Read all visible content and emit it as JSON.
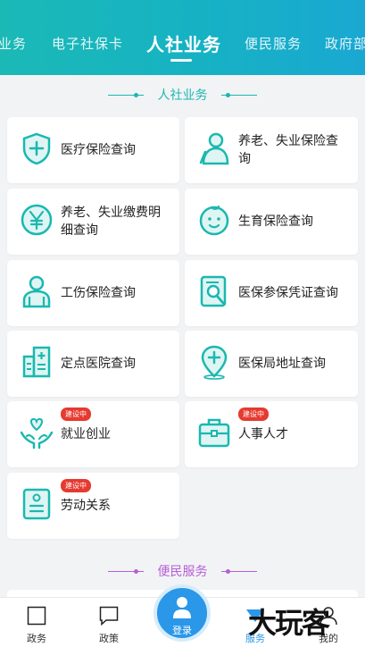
{
  "top_tabs": [
    {
      "label": "业务"
    },
    {
      "label": "电子社保卡"
    },
    {
      "label": "人社业务"
    },
    {
      "label": "便民服务"
    },
    {
      "label": "政府部"
    }
  ],
  "section1": {
    "title": "人社业务",
    "color": "#1ab8b0"
  },
  "cards": [
    {
      "label_line1": "医疗保险查询",
      "label_line2": "",
      "icon": "shield-plus-icon"
    },
    {
      "label_line1": "养老、失业保险查",
      "label_line2": "询",
      "icon": "elderly-person-icon"
    },
    {
      "label_line1": "养老、失业缴费明",
      "label_line2": "细查询",
      "icon": "yuan-coin-icon"
    },
    {
      "label_line1": "生育保险查询",
      "label_line2": "",
      "icon": "baby-face-icon"
    },
    {
      "label_line1": "工伤保险查询",
      "label_line2": "",
      "icon": "injured-person-icon"
    },
    {
      "label_line1": "医保参保凭证查询",
      "label_line2": "",
      "icon": "document-search-icon"
    },
    {
      "label_line1": "定点医院查询",
      "label_line2": "",
      "icon": "hospital-icon"
    },
    {
      "label_line1": "医保局地址查询",
      "label_line2": "",
      "icon": "location-pin-icon"
    },
    {
      "label_line1": "就业创业",
      "label_line2": "",
      "icon": "hands-heart-icon",
      "badge": "建设中"
    },
    {
      "label_line1": "人事人才",
      "label_line2": "",
      "icon": "briefcase-icon",
      "badge": "建设中"
    },
    {
      "label_line1": "劳动关系",
      "label_line2": "",
      "icon": "contract-icon",
      "badge": "建设中"
    }
  ],
  "section2": {
    "title": "便民服务",
    "color": "#b65fd6"
  },
  "bottom_nav": {
    "items": [
      {
        "label": "政务"
      },
      {
        "label": "政策"
      },
      {
        "label": "服务"
      },
      {
        "label": "我的"
      }
    ],
    "login_label": "登录"
  },
  "watermark": "大玩客",
  "colors": {
    "accent": "#1ab8b0",
    "badge": "#e63a30",
    "login": "#2a97e8",
    "active_nav": "#2a97e8"
  }
}
